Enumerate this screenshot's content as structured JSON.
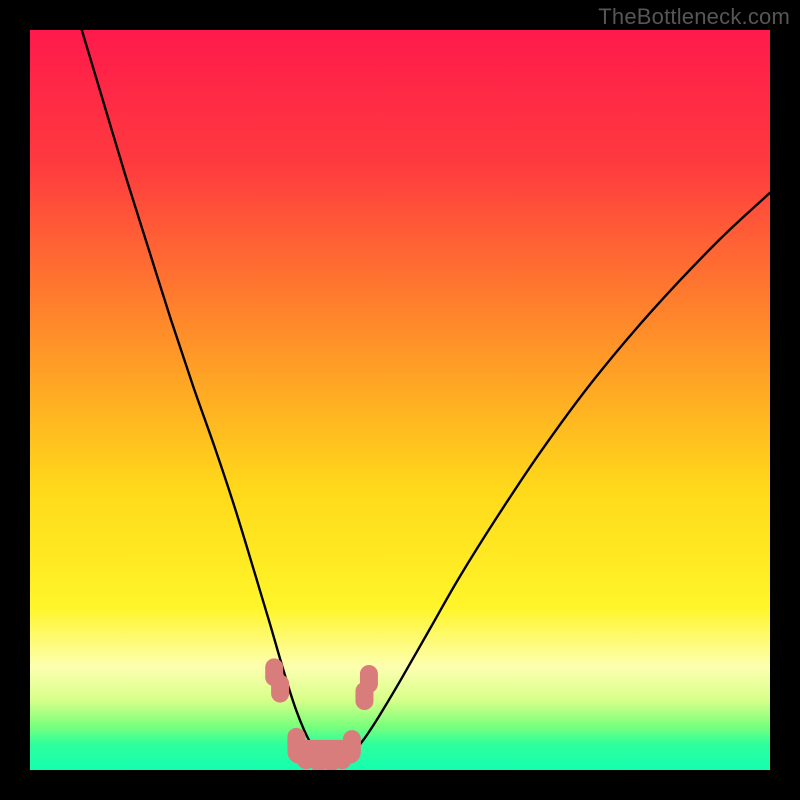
{
  "watermark": "TheBottleneck.com",
  "chart_data": {
    "type": "line",
    "title": "",
    "xlabel": "",
    "ylabel": "",
    "xlim": [
      0,
      100
    ],
    "ylim": [
      0,
      100
    ],
    "gradient_stops": [
      {
        "offset": 0.0,
        "color": "#ff1a4b"
      },
      {
        "offset": 0.18,
        "color": "#ff3a3f"
      },
      {
        "offset": 0.4,
        "color": "#ff8a2a"
      },
      {
        "offset": 0.62,
        "color": "#ffd91a"
      },
      {
        "offset": 0.78,
        "color": "#fff52a"
      },
      {
        "offset": 0.86,
        "color": "#fdffb0"
      },
      {
        "offset": 0.905,
        "color": "#d8ff8a"
      },
      {
        "offset": 0.94,
        "color": "#7cff7c"
      },
      {
        "offset": 0.965,
        "color": "#2fff9c"
      },
      {
        "offset": 1.0,
        "color": "#13ffb0"
      }
    ],
    "series": [
      {
        "name": "bottleneck-curve",
        "x": [
          7.0,
          10.0,
          13.0,
          16.0,
          19.0,
          22.0,
          25.0,
          27.5,
          29.5,
          31.0,
          32.5,
          33.8,
          35.0,
          36.0,
          37.0,
          38.0,
          39.0,
          40.0,
          40.7,
          41.3,
          42.0,
          43.5,
          45.0,
          47.0,
          50.0,
          54.0,
          58.0,
          63.0,
          69.0,
          76.0,
          84.0,
          93.0,
          100.0
        ],
        "values": [
          100.0,
          90.0,
          80.0,
          70.5,
          61.0,
          52.0,
          43.5,
          36.0,
          29.5,
          24.5,
          19.5,
          15.0,
          11.0,
          8.0,
          5.5,
          3.5,
          2.2,
          1.3,
          1.0,
          1.0,
          1.3,
          2.3,
          4.0,
          7.0,
          12.0,
          19.0,
          26.0,
          34.0,
          43.0,
          52.5,
          62.0,
          71.5,
          78.0
        ]
      }
    ],
    "markers": {
      "name": "highlight-cluster",
      "color": "#d97c7c",
      "points": [
        {
          "x": 33.0,
          "y": 13.2
        },
        {
          "x": 33.8,
          "y": 11.0
        },
        {
          "x": 36.0,
          "y": 3.8
        },
        {
          "x": 37.3,
          "y": 2.0
        },
        {
          "x": 39.0,
          "y": 1.7
        },
        {
          "x": 40.7,
          "y": 1.7
        },
        {
          "x": 42.2,
          "y": 2.0
        },
        {
          "x": 43.5,
          "y": 3.5
        },
        {
          "x": 45.2,
          "y": 10.0
        },
        {
          "x": 45.8,
          "y": 12.3
        }
      ]
    }
  }
}
